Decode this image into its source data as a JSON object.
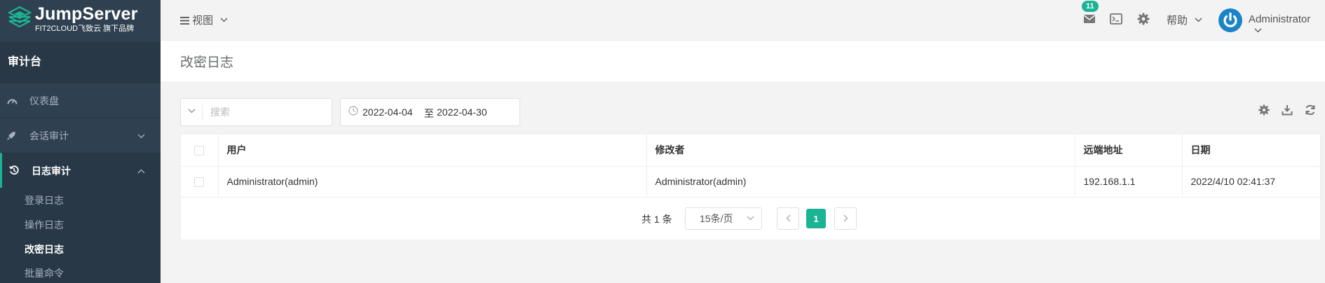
{
  "brand": {
    "title": "JumpServer",
    "subtitle": "FIT2CLOUD飞致云 旗下品牌"
  },
  "sidebar": {
    "console_title": "审计台",
    "items": [
      {
        "label": "仪表盘",
        "icon": "dashboard-icon"
      },
      {
        "label": "会话审计",
        "icon": "rocket-icon",
        "expanded": false
      },
      {
        "label": "日志审计",
        "icon": "history-icon",
        "expanded": true
      }
    ],
    "sub_items": [
      {
        "label": "登录日志"
      },
      {
        "label": "操作日志"
      },
      {
        "label": "改密日志",
        "current": true
      },
      {
        "label": "批量命令"
      }
    ]
  },
  "topbar": {
    "view_label": "视图",
    "mail_badge": "11",
    "help_label": "帮助",
    "user_name": "Administrator"
  },
  "page": {
    "title": "改密日志"
  },
  "filters": {
    "search_placeholder": "搜索",
    "date_start": "2022-04-04",
    "date_sep": "至",
    "date_end": "2022-04-30"
  },
  "table": {
    "columns": [
      "用户",
      "修改者",
      "远端地址",
      "日期"
    ],
    "rows": [
      [
        "Administrator(admin)",
        "Administrator(admin)",
        "192.168.1.1",
        "2022/4/10 02:41:37"
      ]
    ]
  },
  "pagination": {
    "total_text": "共 1 条",
    "page_size": "15条/页",
    "current_page": "1"
  },
  "colors": {
    "sidebar_bg": "#2f4050",
    "accent": "#1ab394",
    "avatar": "#1c84c6"
  }
}
